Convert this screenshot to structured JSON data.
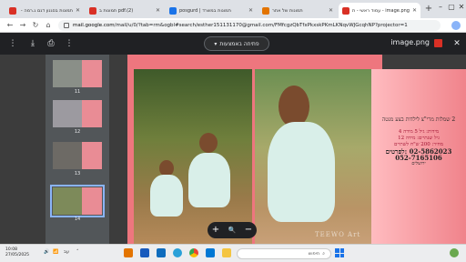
{
  "tabs": [
    {
      "title": "תמונות בסגנון דגם ג.רמה - Gmail",
      "active": false,
      "favicon_color": "#d93025"
    },
    {
      "title": "pdf.(2) תמונות ב",
      "active": false,
      "favicon_color": "#d93025"
    },
    {
      "title": "תמונות במשרד | posgurd",
      "active": false,
      "favicon_color": "#1a73e8"
    },
    {
      "title": "תמונות של אתר",
      "active": false,
      "favicon_color": "#e37400"
    },
    {
      "title": "image.png - עמוד ראשי - תמונות בגדגם",
      "active": true,
      "favicon_color": "#d93025"
    }
  ],
  "address": {
    "host": "mail.google.com",
    "path": "/mail/u/0/?tab=rm&ogbl#search/esther151131170@gmail.com/FMfcgzQbTfxPkxskPKmLKNqvWJGcqhNP?projector=1"
  },
  "viewer": {
    "open_with_label": "פתיחה באמצעות",
    "filename": "image.png"
  },
  "thumbnails": [
    {
      "page": "11",
      "selected": false
    },
    {
      "page": "12",
      "selected": false
    },
    {
      "page": "13",
      "selected": false
    },
    {
      "page": "14",
      "selected": true
    }
  ],
  "image_text": {
    "line1": "2 שמלות מרי\"צ לילדות בצע מנטה",
    "line2": "מידות: גיל 5 מידה 4",
    "line3": "גיל שנתיים: מידה 12",
    "line4": "מחיר: 200 ש\"ח לשתיים",
    "line5": "02-5862023 :לפרטים",
    "line6": "052-7165106",
    "line7": "ירושלים",
    "watermark": "TEEWO Art"
  },
  "zoom": {
    "plus": "+",
    "magnifier": "🔍",
    "minus": "−"
  },
  "taskbar": {
    "time": "10:08",
    "date": "27/05/2025",
    "lang": "עב",
    "search_placeholder": "חיפוש"
  }
}
